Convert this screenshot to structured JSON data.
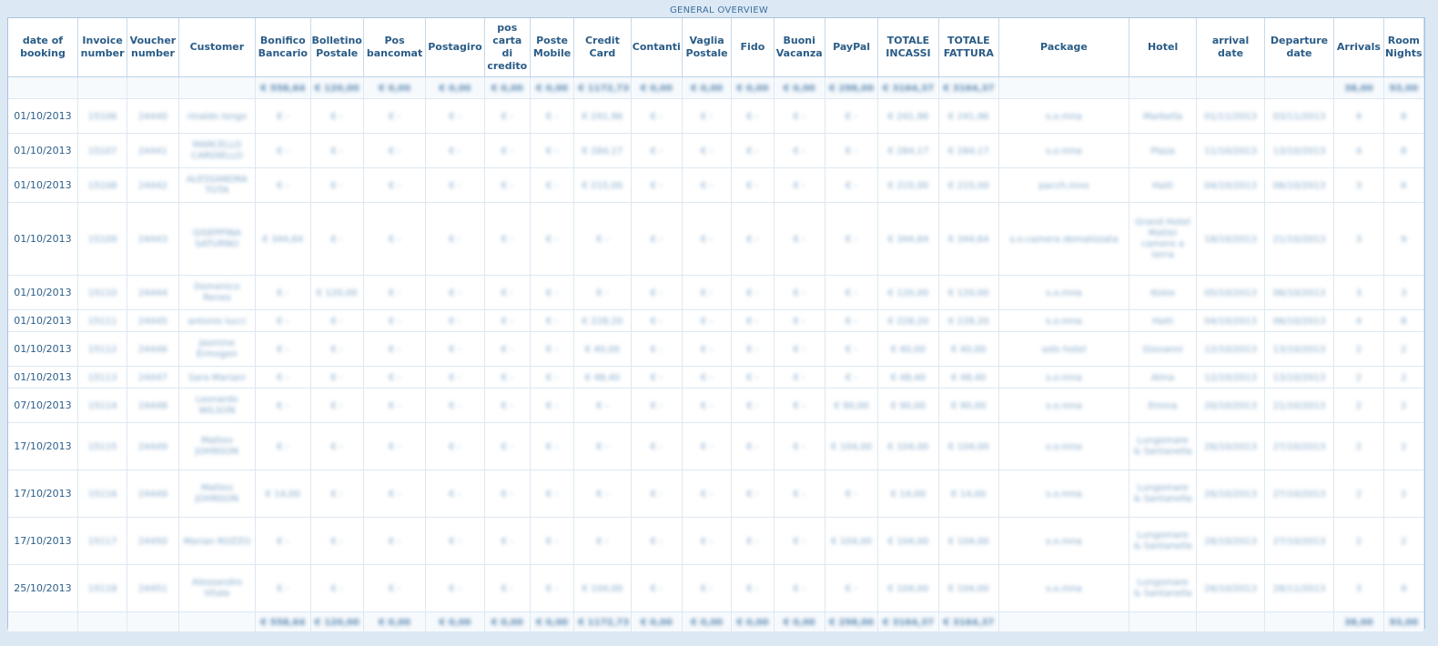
{
  "panel": {
    "title": "GENERAL OVERVIEW"
  },
  "columns": [
    {
      "key": "date",
      "label": "date of booking",
      "width": 76
    },
    {
      "key": "invoice",
      "label": "Invoice number",
      "width": 54
    },
    {
      "key": "voucher",
      "label": "Voucher number",
      "width": 56
    },
    {
      "key": "customer",
      "label": "Customer",
      "width": 84
    },
    {
      "key": "bonifico",
      "label": "Bonifico Bancario",
      "width": 60
    },
    {
      "key": "bollettino",
      "label": "Bolletino Postale",
      "width": 58
    },
    {
      "key": "pos",
      "label": "Pos bancomat",
      "width": 68
    },
    {
      "key": "postagiro",
      "label": "Postagiro",
      "width": 64
    },
    {
      "key": "poscarta",
      "label": "pos carta di credito",
      "width": 50
    },
    {
      "key": "postemobile",
      "label": "Poste Mobile",
      "width": 48
    },
    {
      "key": "credit",
      "label": "Credit Card",
      "width": 62
    },
    {
      "key": "contanti",
      "label": "Contanti",
      "width": 56
    },
    {
      "key": "vaglia",
      "label": "Vaglia Postale",
      "width": 54
    },
    {
      "key": "fido",
      "label": "Fido",
      "width": 46
    },
    {
      "key": "buoni",
      "label": "Buoni Vacanza",
      "width": 56
    },
    {
      "key": "paypal",
      "label": "PayPal",
      "width": 58
    },
    {
      "key": "incassi",
      "label": "TOTALE INCASSI",
      "width": 66
    },
    {
      "key": "fattura",
      "label": "TOTALE FATTURA",
      "width": 66
    },
    {
      "key": "package",
      "label": "Package",
      "width": 142
    },
    {
      "key": "hotel",
      "label": "Hotel",
      "width": 74
    },
    {
      "key": "arrival",
      "label": "arrival date",
      "width": 74
    },
    {
      "key": "departure",
      "label": "Departure date",
      "width": 76
    },
    {
      "key": "arrivals",
      "label": "Arrivals",
      "width": 54
    },
    {
      "key": "nights",
      "label": "Room Nights",
      "width": 44
    }
  ],
  "totals": {
    "bonifico": "€ 558,64",
    "bollettino": "€ 120,00",
    "pos": "€ 0,00",
    "postagiro": "€ 0,00",
    "poscarta": "€ 0,00",
    "postemobile": "€ 0,00",
    "credit": "€ 1172,73",
    "contanti": "€ 0,00",
    "vaglia": "€ 0,00",
    "fido": "€ 0,00",
    "buoni": "€ 0,00",
    "paypal": "€ 298,00",
    "incassi": "€ 3164,37",
    "fattura": "€ 3164,37",
    "arrivals": "38,00",
    "nights": "93,00"
  },
  "rows": [
    {
      "date": "01/10/2013",
      "invoice": "15106",
      "voucher": "24440",
      "customer": "rinaldo longo",
      "bonifico": "€ -",
      "bollettino": "€ -",
      "pos": "€ -",
      "postagiro": "€ -",
      "poscarta": "€ -",
      "postemobile": "€ -",
      "credit": "€ 241,96",
      "contanti": "€ -",
      "vaglia": "€ -",
      "fido": "€ -",
      "buoni": "€ -",
      "paypal": "€ -",
      "incassi": "€ 241,96",
      "fattura": "€ 241,96",
      "package": "s.o.mna",
      "hotel": "Marbella",
      "arrival": "01/11/2013",
      "departure": "03/11/2013",
      "arrivals": "4",
      "nights": "8",
      "h": 38
    },
    {
      "date": "01/10/2013",
      "invoice": "15107",
      "voucher": "24441",
      "customer": "MARCELLO CARDIELLO",
      "bonifico": "€ -",
      "bollettino": "€ -",
      "pos": "€ -",
      "postagiro": "€ -",
      "poscarta": "€ -",
      "postemobile": "€ -",
      "credit": "€ 284,17",
      "contanti": "€ -",
      "vaglia": "€ -",
      "fido": "€ -",
      "buoni": "€ -",
      "paypal": "€ -",
      "incassi": "€ 284,17",
      "fattura": "€ 284,17",
      "package": "s.o.mna",
      "hotel": "Plaza",
      "arrival": "11/10/2013",
      "departure": "13/10/2013",
      "arrivals": "4",
      "nights": "8",
      "h": 38
    },
    {
      "date": "01/10/2013",
      "invoice": "15108",
      "voucher": "24442",
      "customer": "ALESSANDRA TOTA",
      "bonifico": "€ -",
      "bollettino": "€ -",
      "pos": "€ -",
      "postagiro": "€ -",
      "poscarta": "€ -",
      "postemobile": "€ -",
      "credit": "€ 215,00",
      "contanti": "€ -",
      "vaglia": "€ -",
      "fido": "€ -",
      "buoni": "€ -",
      "paypal": "€ -",
      "incassi": "€ 215,00",
      "fattura": "€ 215,00",
      "package": "pacch.mno",
      "hotel": "Haiti",
      "arrival": "04/10/2013",
      "departure": "06/10/2013",
      "arrivals": "3",
      "nights": "6",
      "h": 38
    },
    {
      "date": "01/10/2013",
      "invoice": "15109",
      "voucher": "24443",
      "customer": "GISEPPINA SATURNO",
      "bonifico": "€ 344,64",
      "bollettino": "€ -",
      "pos": "€ -",
      "postagiro": "€ -",
      "poscarta": "€ -",
      "postemobile": "€ -",
      "credit": "€ -",
      "contanti": "€ -",
      "vaglia": "€ -",
      "fido": "€ -",
      "buoni": "€ -",
      "paypal": "€ -",
      "incassi": "€ 344,64",
      "fattura": "€ 344,64",
      "package": "s.o.camera demalizzata",
      "hotel": "Grand Hotel Mattei camere a terra",
      "arrival": "18/10/2013",
      "departure": "21/10/2013",
      "arrivals": "3",
      "nights": "9",
      "h": 80
    },
    {
      "date": "01/10/2013",
      "invoice": "15110",
      "voucher": "24444",
      "customer": "Domenico Renes",
      "bonifico": "€ -",
      "bollettino": "€ 120,00",
      "pos": "€ -",
      "postagiro": "€ -",
      "poscarta": "€ -",
      "postemobile": "€ -",
      "credit": "€ -",
      "contanti": "€ -",
      "vaglia": "€ -",
      "fido": "€ -",
      "buoni": "€ -",
      "paypal": "€ -",
      "incassi": "€ 120,00",
      "fattura": "€ 120,00",
      "package": "s.o.mna",
      "hotel": "Kolos",
      "arrival": "05/10/2013",
      "departure": "06/10/2013",
      "arrivals": "3",
      "nights": "3",
      "h": 38
    },
    {
      "date": "01/10/2013",
      "invoice": "15111",
      "voucher": "24445",
      "customer": "antonio lucci",
      "bonifico": "€ -",
      "bollettino": "€ -",
      "pos": "€ -",
      "postagiro": "€ -",
      "poscarta": "€ -",
      "postemobile": "€ -",
      "credit": "€ 228,20",
      "contanti": "€ -",
      "vaglia": "€ -",
      "fido": "€ -",
      "buoni": "€ -",
      "paypal": "€ -",
      "incassi": "€ 228,20",
      "fattura": "€ 228,20",
      "package": "s.o.mna",
      "hotel": "Haiti",
      "arrival": "04/10/2013",
      "departure": "06/10/2013",
      "arrivals": "4",
      "nights": "8",
      "h": 24
    },
    {
      "date": "01/10/2013",
      "invoice": "15112",
      "voucher": "24446",
      "customer": "Jasmine Ermogen",
      "bonifico": "€ -",
      "bollettino": "€ -",
      "pos": "€ -",
      "postagiro": "€ -",
      "poscarta": "€ -",
      "postemobile": "€ -",
      "credit": "€ 40,00",
      "contanti": "€ -",
      "vaglia": "€ -",
      "fido": "€ -",
      "buoni": "€ -",
      "paypal": "€ -",
      "incassi": "€ 40,00",
      "fattura": "€ 40,00",
      "package": "solo hotel",
      "hotel": "Giovanni",
      "arrival": "12/10/2013",
      "departure": "13/10/2013",
      "arrivals": "2",
      "nights": "2",
      "h": 38
    },
    {
      "date": "01/10/2013",
      "invoice": "15113",
      "voucher": "24447",
      "customer": "Sara Mariani",
      "bonifico": "€ -",
      "bollettino": "€ -",
      "pos": "€ -",
      "postagiro": "€ -",
      "poscarta": "€ -",
      "postemobile": "€ -",
      "credit": "€ 48,40",
      "contanti": "€ -",
      "vaglia": "€ -",
      "fido": "€ -",
      "buoni": "€ -",
      "paypal": "€ -",
      "incassi": "€ 48,40",
      "fattura": "€ 48,40",
      "package": "s.o.mna",
      "hotel": "Alma",
      "arrival": "12/10/2013",
      "departure": "13/10/2013",
      "arrivals": "2",
      "nights": "2",
      "h": 24
    },
    {
      "date": "07/10/2013",
      "invoice": "15114",
      "voucher": "24448",
      "customer": "Leonardo WILSON",
      "bonifico": "€ -",
      "bollettino": "€ -",
      "pos": "€ -",
      "postagiro": "€ -",
      "poscarta": "€ -",
      "postemobile": "€ -",
      "credit": "€ -",
      "contanti": "€ -",
      "vaglia": "€ -",
      "fido": "€ -",
      "buoni": "€ -",
      "paypal": "€ 90,00",
      "incassi": "€ 90,00",
      "fattura": "€ 90,00",
      "package": "s.o.mna",
      "hotel": "Emma",
      "arrival": "20/10/2013",
      "departure": "21/10/2013",
      "arrivals": "2",
      "nights": "2",
      "h": 38
    },
    {
      "date": "17/10/2013",
      "invoice": "15115",
      "voucher": "24449",
      "customer": "Matteo JOHNSON",
      "bonifico": "€ -",
      "bollettino": "€ -",
      "pos": "€ -",
      "postagiro": "€ -",
      "poscarta": "€ -",
      "postemobile": "€ -",
      "credit": "€ -",
      "contanti": "€ -",
      "vaglia": "€ -",
      "fido": "€ -",
      "buoni": "€ -",
      "paypal": "€ 104,00",
      "incassi": "€ 104,00",
      "fattura": "€ 104,00",
      "package": "s.o.mna",
      "hotel": "Lungomare & Santanella",
      "arrival": "26/10/2013",
      "departure": "27/10/2013",
      "arrivals": "2",
      "nights": "2",
      "h": 52
    },
    {
      "date": "17/10/2013",
      "invoice": "15116",
      "voucher": "24449",
      "customer": "Matteo JOHNSON",
      "bonifico": "€ 14,00",
      "bollettino": "€ -",
      "pos": "€ -",
      "postagiro": "€ -",
      "poscarta": "€ -",
      "postemobile": "€ -",
      "credit": "€ -",
      "contanti": "€ -",
      "vaglia": "€ -",
      "fido": "€ -",
      "buoni": "€ -",
      "paypal": "€ -",
      "incassi": "€ 14,00",
      "fattura": "€ 14,00",
      "package": "s.o.mna",
      "hotel": "Lungomare & Santanella",
      "arrival": "26/10/2013",
      "departure": "27/10/2013",
      "arrivals": "2",
      "nights": "2",
      "h": 52
    },
    {
      "date": "17/10/2013",
      "invoice": "15117",
      "voucher": "24450",
      "customer": "Marian ROZZO",
      "bonifico": "€ -",
      "bollettino": "€ -",
      "pos": "€ -",
      "postagiro": "€ -",
      "poscarta": "€ -",
      "postemobile": "€ -",
      "credit": "€ -",
      "contanti": "€ -",
      "vaglia": "€ -",
      "fido": "€ -",
      "buoni": "€ -",
      "paypal": "€ 104,00",
      "incassi": "€ 104,00",
      "fattura": "€ 104,00",
      "package": "s.o.mna",
      "hotel": "Lungomare & Santanella",
      "arrival": "26/10/2013",
      "departure": "27/10/2013",
      "arrivals": "2",
      "nights": "2",
      "h": 52
    },
    {
      "date": "25/10/2013",
      "invoice": "15118",
      "voucher": "24451",
      "customer": "Alessandro Vitale",
      "bonifico": "€ -",
      "bollettino": "€ -",
      "pos": "€ -",
      "postagiro": "€ -",
      "poscarta": "€ -",
      "postemobile": "€ -",
      "credit": "€ 104,00",
      "contanti": "€ -",
      "vaglia": "€ -",
      "fido": "€ -",
      "buoni": "€ -",
      "paypal": "€ -",
      "incassi": "€ 104,00",
      "fattura": "€ 104,00",
      "package": "s.o.mna",
      "hotel": "Lungomare & Santanella",
      "arrival": "26/10/2013",
      "departure": "28/11/2013",
      "arrivals": "3",
      "nights": "9",
      "h": 52
    }
  ]
}
